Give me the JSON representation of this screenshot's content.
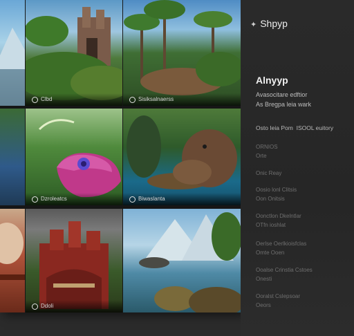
{
  "app": {
    "brand": "Shpyp",
    "brand_icon": "sparkle-icon"
  },
  "details": {
    "title": "Alnyyp",
    "subtitle": "Avasocitare edftior\nAs Bregpa leia wark",
    "header_row": "Osto Ieia Pom  ISOOL euitory",
    "meta": [
      "ORNIOS\nOrte",
      "Onic Reay",
      "Oosio lonl Clitsis\nOon Onitsis",
      "Oonctlon Dkelntlar\nOTfn ioshlat",
      "Oerlse Oerlkioisfclas\nOmte Ooen",
      "Ooalse Crinstia Cstoes\nOnesti",
      "Ooralst Cslepsoar\nOeors"
    ]
  },
  "gallery": {
    "tiles": [
      {
        "name": "tile-mountain-lake",
        "caption": ""
      },
      {
        "name": "tile-jungle-temple",
        "caption": "Clbd"
      },
      {
        "name": "tile-palm-forest",
        "caption": "Sisiksalnaerss"
      },
      {
        "name": "tile-blue-forest",
        "caption": ""
      },
      {
        "name": "tile-pink-creature",
        "caption": "Dzroleatcs"
      },
      {
        "name": "tile-hippo-creature",
        "caption": "Biwaslanta"
      },
      {
        "name": "tile-desert-canyon",
        "caption": ""
      },
      {
        "name": "tile-red-palace",
        "caption": "Ddoli"
      },
      {
        "name": "tile-mountain-bay",
        "caption": ""
      }
    ]
  },
  "colors": {
    "panel_bg": "#2a2a2a",
    "gallery_bg": "#161616",
    "title_text": "#f0f0f0",
    "muted_text": "#6f6f6f"
  }
}
